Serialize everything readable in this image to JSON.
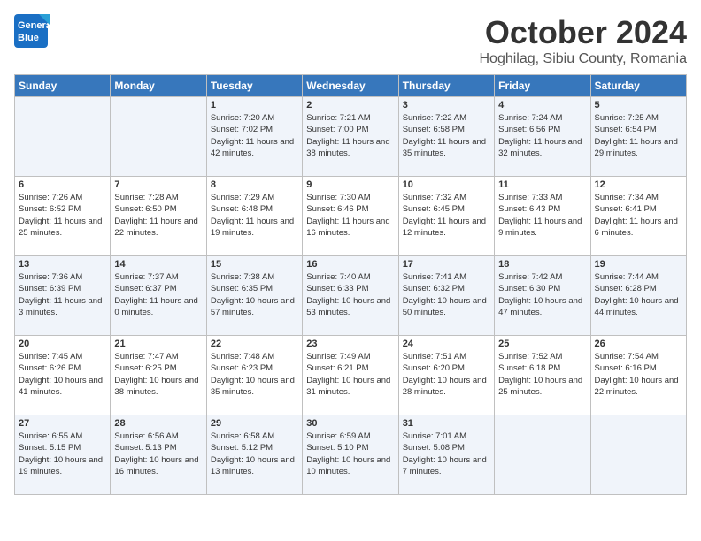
{
  "header": {
    "logo_line1": "General",
    "logo_line2": "Blue",
    "month": "October 2024",
    "location": "Hoghilag, Sibiu County, Romania"
  },
  "days_of_week": [
    "Sunday",
    "Monday",
    "Tuesday",
    "Wednesday",
    "Thursday",
    "Friday",
    "Saturday"
  ],
  "weeks": [
    [
      {
        "day": "",
        "info": ""
      },
      {
        "day": "",
        "info": ""
      },
      {
        "day": "1",
        "info": "Sunrise: 7:20 AM\nSunset: 7:02 PM\nDaylight: 11 hours and 42 minutes."
      },
      {
        "day": "2",
        "info": "Sunrise: 7:21 AM\nSunset: 7:00 PM\nDaylight: 11 hours and 38 minutes."
      },
      {
        "day": "3",
        "info": "Sunrise: 7:22 AM\nSunset: 6:58 PM\nDaylight: 11 hours and 35 minutes."
      },
      {
        "day": "4",
        "info": "Sunrise: 7:24 AM\nSunset: 6:56 PM\nDaylight: 11 hours and 32 minutes."
      },
      {
        "day": "5",
        "info": "Sunrise: 7:25 AM\nSunset: 6:54 PM\nDaylight: 11 hours and 29 minutes."
      }
    ],
    [
      {
        "day": "6",
        "info": "Sunrise: 7:26 AM\nSunset: 6:52 PM\nDaylight: 11 hours and 25 minutes."
      },
      {
        "day": "7",
        "info": "Sunrise: 7:28 AM\nSunset: 6:50 PM\nDaylight: 11 hours and 22 minutes."
      },
      {
        "day": "8",
        "info": "Sunrise: 7:29 AM\nSunset: 6:48 PM\nDaylight: 11 hours and 19 minutes."
      },
      {
        "day": "9",
        "info": "Sunrise: 7:30 AM\nSunset: 6:46 PM\nDaylight: 11 hours and 16 minutes."
      },
      {
        "day": "10",
        "info": "Sunrise: 7:32 AM\nSunset: 6:45 PM\nDaylight: 11 hours and 12 minutes."
      },
      {
        "day": "11",
        "info": "Sunrise: 7:33 AM\nSunset: 6:43 PM\nDaylight: 11 hours and 9 minutes."
      },
      {
        "day": "12",
        "info": "Sunrise: 7:34 AM\nSunset: 6:41 PM\nDaylight: 11 hours and 6 minutes."
      }
    ],
    [
      {
        "day": "13",
        "info": "Sunrise: 7:36 AM\nSunset: 6:39 PM\nDaylight: 11 hours and 3 minutes."
      },
      {
        "day": "14",
        "info": "Sunrise: 7:37 AM\nSunset: 6:37 PM\nDaylight: 11 hours and 0 minutes."
      },
      {
        "day": "15",
        "info": "Sunrise: 7:38 AM\nSunset: 6:35 PM\nDaylight: 10 hours and 57 minutes."
      },
      {
        "day": "16",
        "info": "Sunrise: 7:40 AM\nSunset: 6:33 PM\nDaylight: 10 hours and 53 minutes."
      },
      {
        "day": "17",
        "info": "Sunrise: 7:41 AM\nSunset: 6:32 PM\nDaylight: 10 hours and 50 minutes."
      },
      {
        "day": "18",
        "info": "Sunrise: 7:42 AM\nSunset: 6:30 PM\nDaylight: 10 hours and 47 minutes."
      },
      {
        "day": "19",
        "info": "Sunrise: 7:44 AM\nSunset: 6:28 PM\nDaylight: 10 hours and 44 minutes."
      }
    ],
    [
      {
        "day": "20",
        "info": "Sunrise: 7:45 AM\nSunset: 6:26 PM\nDaylight: 10 hours and 41 minutes."
      },
      {
        "day": "21",
        "info": "Sunrise: 7:47 AM\nSunset: 6:25 PM\nDaylight: 10 hours and 38 minutes."
      },
      {
        "day": "22",
        "info": "Sunrise: 7:48 AM\nSunset: 6:23 PM\nDaylight: 10 hours and 35 minutes."
      },
      {
        "day": "23",
        "info": "Sunrise: 7:49 AM\nSunset: 6:21 PM\nDaylight: 10 hours and 31 minutes."
      },
      {
        "day": "24",
        "info": "Sunrise: 7:51 AM\nSunset: 6:20 PM\nDaylight: 10 hours and 28 minutes."
      },
      {
        "day": "25",
        "info": "Sunrise: 7:52 AM\nSunset: 6:18 PM\nDaylight: 10 hours and 25 minutes."
      },
      {
        "day": "26",
        "info": "Sunrise: 7:54 AM\nSunset: 6:16 PM\nDaylight: 10 hours and 22 minutes."
      }
    ],
    [
      {
        "day": "27",
        "info": "Sunrise: 6:55 AM\nSunset: 5:15 PM\nDaylight: 10 hours and 19 minutes."
      },
      {
        "day": "28",
        "info": "Sunrise: 6:56 AM\nSunset: 5:13 PM\nDaylight: 10 hours and 16 minutes."
      },
      {
        "day": "29",
        "info": "Sunrise: 6:58 AM\nSunset: 5:12 PM\nDaylight: 10 hours and 13 minutes."
      },
      {
        "day": "30",
        "info": "Sunrise: 6:59 AM\nSunset: 5:10 PM\nDaylight: 10 hours and 10 minutes."
      },
      {
        "day": "31",
        "info": "Sunrise: 7:01 AM\nSunset: 5:08 PM\nDaylight: 10 hours and 7 minutes."
      },
      {
        "day": "",
        "info": ""
      },
      {
        "day": "",
        "info": ""
      }
    ]
  ]
}
